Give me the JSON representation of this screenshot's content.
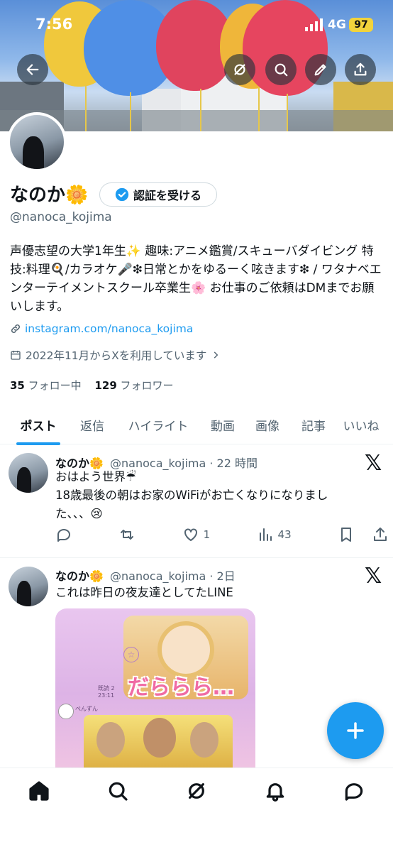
{
  "status_bar": {
    "time": "7:56",
    "network": "4G",
    "battery": "97"
  },
  "profile": {
    "name": "なのか🌼",
    "verify_button": "認証を受ける",
    "handle": "@nanoca_kojima",
    "bio": "声優志望の大学1年生✨ 趣味:アニメ鑑賞/スキューバダイビング 特技:料理🍳/カラオケ🎤❇︎日常とかをゆるーく呟きます❇︎ / ワタナベエンターテイメントスクール卒業生🌸 お仕事のご依頼はDMまでお願いします。",
    "link": "instagram.com/nanoca_kojima",
    "joined": "2022年11月からXを利用しています",
    "following_count": "35",
    "following_label": "フォロー中",
    "followers_count": "129",
    "followers_label": "フォロワー"
  },
  "tabs": [
    "ポスト",
    "返信",
    "ハイライト",
    "動画",
    "画像",
    "記事",
    "いいね"
  ],
  "tweets": [
    {
      "name": "なのか🌼",
      "handle": "@nanoca_kojima",
      "time": "· 22 時間",
      "line1": "おはよう世界☔",
      "line2": "18歳最後の朝はお家のWiFiがお亡くなりになりまし",
      "line3": "た、、、😢",
      "likes": "1",
      "views": "43"
    },
    {
      "name": "なのか🌼",
      "handle": "@nanoca_kojima",
      "time": "· 2日",
      "line1": "これは昨日の夜友達としてたLINE",
      "sticker_text": "だららら…",
      "chat_time": "既読 2\n23:11",
      "chat_sender": "ぺんずん"
    }
  ],
  "icons": {
    "back": "back-arrow-icon",
    "grok": "grok-icon",
    "search": "search-icon",
    "edit": "edit-pencil-icon",
    "share": "share-icon",
    "x_logo": "x-logo",
    "fab": "plus-icon"
  },
  "colors": {
    "accent": "#1d9bf0",
    "text": "#0f1419",
    "muted": "#536471"
  }
}
